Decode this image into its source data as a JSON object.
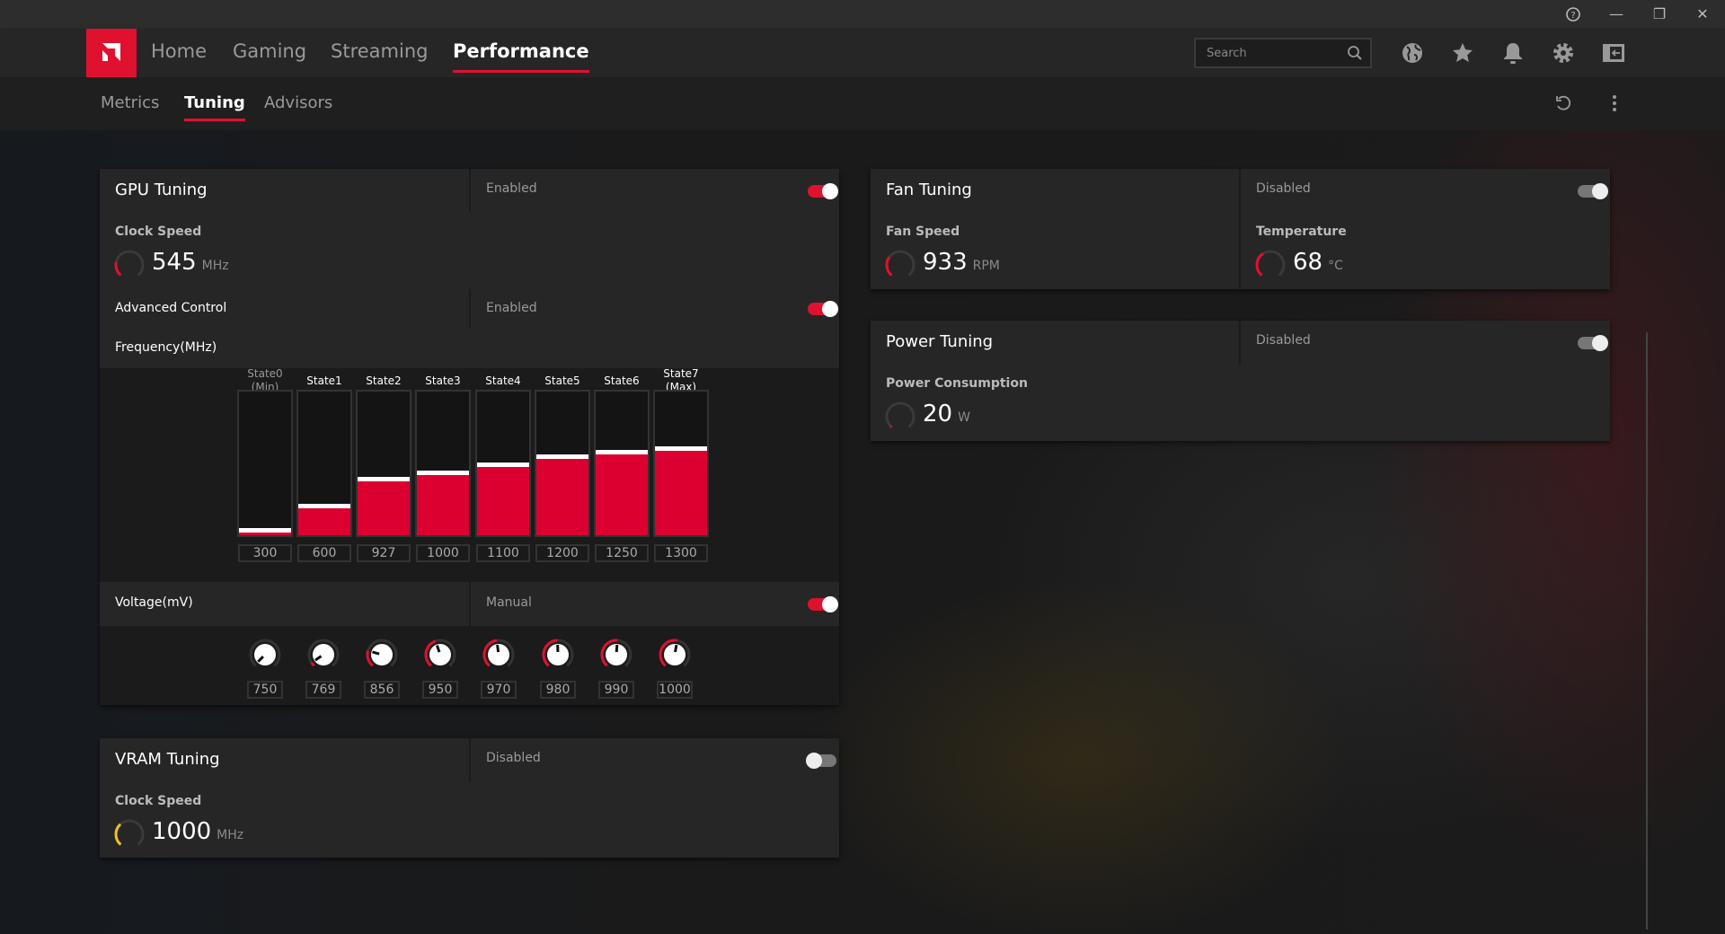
{
  "window": {
    "help": "?",
    "minimize": "—",
    "restore": "❐",
    "close": "✕"
  },
  "nav": {
    "items": [
      "Home",
      "Gaming",
      "Streaming",
      "Performance"
    ],
    "active": 3,
    "search_placeholder": "Search"
  },
  "subnav": {
    "items": [
      "Metrics",
      "Tuning",
      "Advisors"
    ],
    "active": 1
  },
  "gpu": {
    "title": "GPU Tuning",
    "status": "Enabled",
    "enabled": true,
    "clock_label": "Clock Speed",
    "clock_value": "545",
    "clock_unit": "MHz",
    "advanced_label": "Advanced Control",
    "advanced_status": "Enabled",
    "freq_label": "Frequency(MHz)",
    "states": [
      {
        "name": "State0",
        "sub": "(Min)",
        "value": 300
      },
      {
        "name": "State1",
        "value": 600
      },
      {
        "name": "State2",
        "value": 927
      },
      {
        "name": "State3",
        "value": 1000
      },
      {
        "name": "State4",
        "value": 1100
      },
      {
        "name": "State5",
        "value": 1200
      },
      {
        "name": "State6",
        "value": 1250
      },
      {
        "name": "State7",
        "sub": "(Max)",
        "value": 1300
      }
    ],
    "voltage_label": "Voltage(mV)",
    "voltage_status": "Manual",
    "voltages": [
      750,
      769,
      856,
      950,
      970,
      980,
      990,
      1000
    ]
  },
  "fan": {
    "title": "Fan Tuning",
    "status": "Disabled",
    "speed_label": "Fan Speed",
    "speed_value": "933",
    "speed_unit": "RPM",
    "temp_label": "Temperature",
    "temp_value": "68",
    "temp_unit": "°C"
  },
  "power": {
    "title": "Power Tuning",
    "status": "Disabled",
    "label": "Power Consumption",
    "value": "20",
    "unit": "W"
  },
  "vram": {
    "title": "VRAM Tuning",
    "status": "Disabled",
    "clock_label": "Clock Speed",
    "clock_value": "1000",
    "clock_unit": "MHz"
  },
  "colors": {
    "accent": "#e0102f",
    "vram_gauge": "#f0c020"
  }
}
